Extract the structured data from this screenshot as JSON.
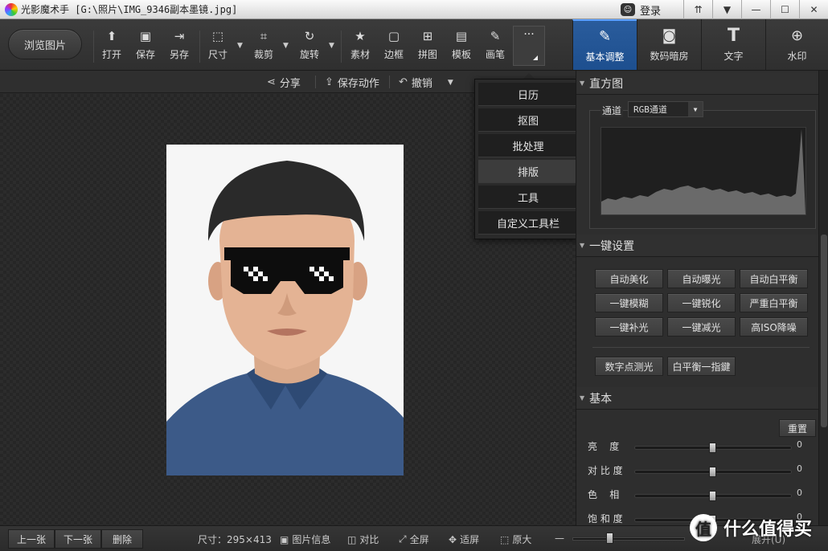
{
  "window": {
    "app_name": "光影魔术手",
    "file_path": "[G:\\照片\\IMG_9346副本墨镜.jpg]",
    "login_label": "登录"
  },
  "toolbar": {
    "browse_label": "浏览图片",
    "tools": [
      {
        "label": "打开",
        "icon": "open-icon"
      },
      {
        "label": "保存",
        "icon": "save-icon"
      },
      {
        "label": "另存",
        "icon": "save-as-icon"
      },
      {
        "label": "尺寸",
        "icon": "resize-icon"
      },
      {
        "label": "裁剪",
        "icon": "crop-icon"
      },
      {
        "label": "旋转",
        "icon": "rotate-icon"
      },
      {
        "label": "素材",
        "icon": "material-icon"
      },
      {
        "label": "边框",
        "icon": "border-icon"
      },
      {
        "label": "拼图",
        "icon": "collage-icon"
      },
      {
        "label": "模板",
        "icon": "template-icon"
      },
      {
        "label": "画笔",
        "icon": "brush-icon"
      }
    ],
    "more_label": "···"
  },
  "right_tabs": [
    {
      "label": "基本调整",
      "active": true
    },
    {
      "label": "数码暗房",
      "active": false
    },
    {
      "label": "文字",
      "active": false
    },
    {
      "label": "水印",
      "active": false
    }
  ],
  "subbar": {
    "share": "分享",
    "save_action": "保存动作",
    "undo": "撤销"
  },
  "more_menu": [
    "日历",
    "抠图",
    "批处理",
    "排版",
    "工具",
    "自定义工具栏"
  ],
  "panel": {
    "histogram": {
      "title": "直方图",
      "channel_label": "通道",
      "channel_value": "RGB通道"
    },
    "one_click": {
      "title": "一键设置",
      "buttons": [
        "自动美化",
        "自动曝光",
        "自动白平衡",
        "一键模糊",
        "一键锐化",
        "严重白平衡",
        "一键补光",
        "一键减光",
        "高ISO降噪"
      ],
      "extra_buttons": [
        "数字点测光",
        "白平衡一指鍵"
      ]
    },
    "basic": {
      "title": "基本",
      "reset_label": "重置",
      "sliders": [
        {
          "label": "亮    度",
          "value": 0
        },
        {
          "label": "对 比 度",
          "value": 0
        },
        {
          "label": "色    相",
          "value": 0
        },
        {
          "label": "饱 和 度",
          "value": 0
        }
      ]
    }
  },
  "bottombar": {
    "prev": "上一张",
    "next": "下一张",
    "delete": "删除",
    "size_text": "尺寸：295×413",
    "info": "图片信息",
    "compare": "对比",
    "fullscreen": "全屏",
    "fit": "适屏",
    "original": "原大",
    "expand": "展开(U)"
  },
  "watermark_text": "什么值得买",
  "colors": {
    "accent_tab": "#1d4f8f",
    "shirt": "#3a5a8c",
    "background": "#2b2b2b"
  }
}
